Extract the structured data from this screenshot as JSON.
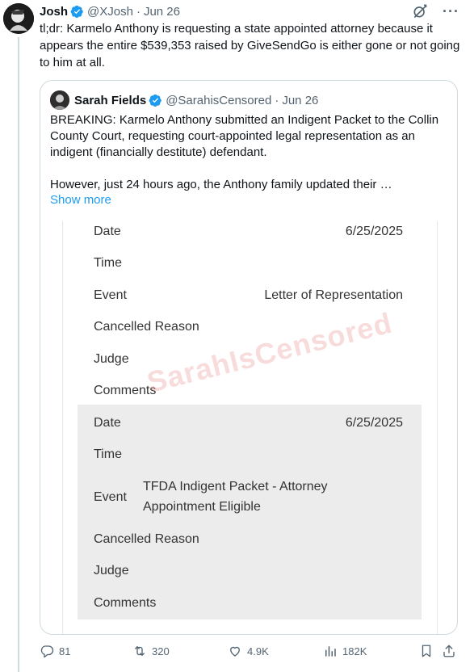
{
  "tweet": {
    "display_name": "Josh",
    "handle": "@XJosh",
    "time": "Jun 26",
    "text": "tl;dr: Karmelo Anthony is requesting a state appointed attorney because it appears the entire $539,353 raised by GiveSendGo is either gone or not going to him at all.",
    "actions": {
      "replies": "81",
      "reposts": "320",
      "likes": "4.9K",
      "views": "182K"
    }
  },
  "quote": {
    "display_name": "Sarah Fields",
    "handle": "@SarahisCensored",
    "time": "Jun 26",
    "paragraph1": "BREAKING: Karmelo Anthony submitted an Indigent Packet to the Collin County Court, requesting court-appointed legal representation as an indigent (financially destitute) defendant.",
    "paragraph2": "However, just 24 hours ago, the Anthony family updated their …",
    "show_more": "Show more"
  },
  "document": {
    "watermark": "SarahIsCensored",
    "record1": {
      "date_label": "Date",
      "date_value": "6/25/2025",
      "time_label": "Time",
      "event_label": "Event",
      "event_value": "Letter of Representation",
      "cancelled_label": "Cancelled Reason",
      "judge_label": "Judge",
      "comments_label": "Comments"
    },
    "record2": {
      "date_label": "Date",
      "date_value": "6/25/2025",
      "time_label": "Time",
      "event_label": "Event",
      "event_value": "TFDA Indigent Packet - Attorney Appointment Eligible",
      "cancelled_label": "Cancelled Reason",
      "judge_label": "Judge",
      "comments_label": "Comments"
    }
  },
  "icons": {
    "verified": "verified-badge-icon",
    "grok": "grok-icon",
    "more": "more-icon",
    "reply": "reply-icon",
    "repost": "repost-icon",
    "like": "like-icon",
    "views": "views-icon",
    "bookmark": "bookmark-icon",
    "share": "share-icon"
  },
  "colors": {
    "accent": "#1d9bf0",
    "secondary_text": "#536471",
    "primary_text": "#0f1419",
    "border": "#cfd9de"
  }
}
